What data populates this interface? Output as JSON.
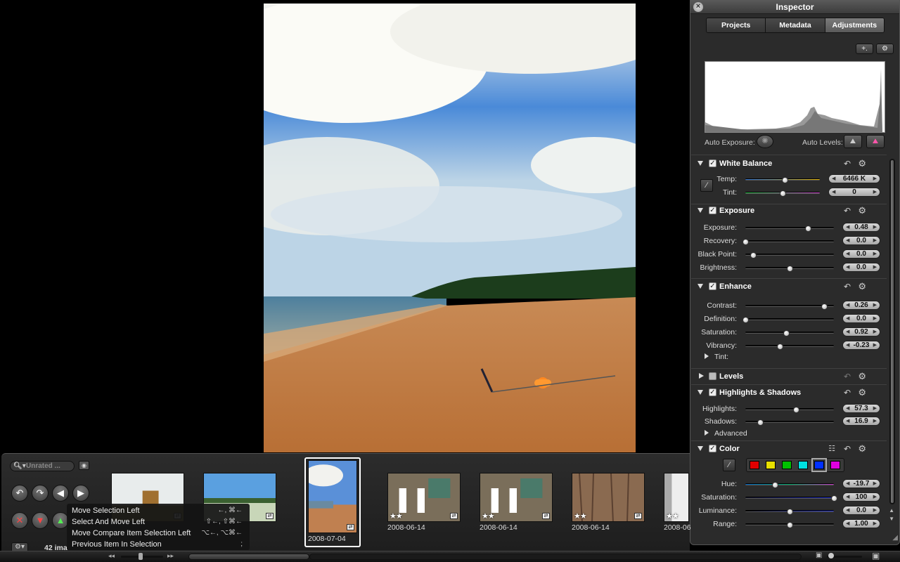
{
  "inspector": {
    "title": "Inspector",
    "close_glyph": "×",
    "tabs": [
      {
        "label": "Projects",
        "active": false
      },
      {
        "label": "Metadata",
        "active": false
      },
      {
        "label": "Adjustments",
        "active": true
      }
    ],
    "add_preset_glyph": "+.",
    "gear_glyph": "⚙",
    "auto_exposure_label": "Auto Exposure:",
    "auto_levels_label": "Auto Levels:"
  },
  "sections": {
    "white_balance": {
      "title": "White Balance",
      "enabled": true,
      "rows": [
        {
          "label": "Temp:",
          "value": "6466 K",
          "level": 0.53
        },
        {
          "label": "Tint:",
          "value": "0",
          "level": 0.5
        }
      ]
    },
    "exposure": {
      "title": "Exposure",
      "enabled": true,
      "rows": [
        {
          "label": "Exposure:",
          "value": "0.48",
          "level": 0.71
        },
        {
          "label": "Recovery:",
          "value": "0.0",
          "level": 0.0
        },
        {
          "label": "Black Point:",
          "value": "0.0",
          "level": 0.09
        },
        {
          "label": "Brightness:",
          "value": "0.0",
          "level": 0.5
        }
      ]
    },
    "enhance": {
      "title": "Enhance",
      "enabled": true,
      "rows": [
        {
          "label": "Contrast:",
          "value": "0.26",
          "level": 0.89
        },
        {
          "label": "Definition:",
          "value": "0.0",
          "level": 0.0
        },
        {
          "label": "Saturation:",
          "value": "0.92",
          "level": 0.46
        },
        {
          "label": "Vibrancy:",
          "value": "-0.23",
          "level": 0.39
        }
      ],
      "sub_tint": "Tint:"
    },
    "levels": {
      "title": "Levels",
      "enabled": false
    },
    "highlights_shadows": {
      "title": "Highlights & Shadows",
      "enabled": true,
      "rows": [
        {
          "label": "Highlights:",
          "value": "57.3",
          "level": 0.57
        },
        {
          "label": "Shadows:",
          "value": "16.9",
          "level": 0.17
        }
      ],
      "sub_advanced": "Advanced"
    },
    "color": {
      "title": "Color",
      "enabled": true,
      "swatches": [
        "#e00000",
        "#e8e000",
        "#00c000",
        "#00e0e0",
        "#0030ff",
        "#e000e0"
      ],
      "selected_swatch": 4,
      "rows": [
        {
          "label": "Hue:",
          "value": "-19.7",
          "level": 0.33
        },
        {
          "label": "Saturation:",
          "value": "100",
          "level": 1.0
        },
        {
          "label": "Luminance:",
          "value": "0.0",
          "level": 0.5
        },
        {
          "label": "Range:",
          "value": "1.00",
          "level": 0.5
        }
      ]
    }
  },
  "filmstrip": {
    "filter_placeholder": "Unrated ...",
    "count_label": "42 ima",
    "thumbs": [
      {
        "stars": "",
        "date": "",
        "kind": "house"
      },
      {
        "stars": "",
        "date": "",
        "kind": "beach-wide"
      },
      {
        "stars": "",
        "date": "2008-07-04",
        "kind": "beach-selected"
      },
      {
        "stars": "★★",
        "date": "2008-06-14",
        "kind": "fountain"
      },
      {
        "stars": "★★",
        "date": "2008-06-14",
        "kind": "fountain"
      },
      {
        "stars": "★★",
        "date": "2008-06-14",
        "kind": "wood"
      },
      {
        "stars": "★★",
        "date": "2008-06",
        "kind": "partial"
      }
    ]
  },
  "context_menu": {
    "items": [
      {
        "label": "Move Selection Left",
        "shortcut": "←, ⌘←"
      },
      {
        "label": "Select And Move Left",
        "shortcut": "⇧←, ⇧⌘←"
      },
      {
        "label": "Move Compare Item Selection Left",
        "shortcut": "⌥←, ⌥⌘←"
      },
      {
        "label": "Previous Item In Selection",
        "shortcut": ";"
      }
    ]
  },
  "colors": {
    "accent_slider_temp_left": "#2a6fd0",
    "accent_slider_temp_right": "#e0b000",
    "accent_slider_tint_left": "#20c040",
    "accent_slider_tint_right": "#d040d0"
  }
}
